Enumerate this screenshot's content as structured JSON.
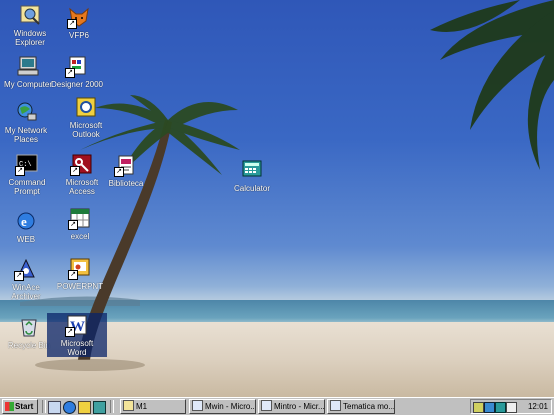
{
  "desktop_icons": [
    {
      "id": "windows-explorer",
      "label": [
        "Windows",
        "Explorer"
      ]
    },
    {
      "id": "vfp6",
      "label": [
        "VFP6"
      ]
    },
    {
      "id": "my-computer",
      "label": [
        "My Computer"
      ]
    },
    {
      "id": "designer-2000",
      "label": [
        "Designer 2000"
      ]
    },
    {
      "id": "my-network-places",
      "label": [
        "My Network",
        "Places"
      ]
    },
    {
      "id": "microsoft-outlook",
      "label": [
        "Microsoft",
        "Outlook"
      ]
    },
    {
      "id": "command-prompt",
      "label": [
        "Command",
        "Prompt"
      ]
    },
    {
      "id": "microsoft-access",
      "label": [
        "Microsoft",
        "Access"
      ]
    },
    {
      "id": "biblioteca",
      "label": [
        "Biblioteca"
      ]
    },
    {
      "id": "calculator",
      "label": [
        "Calculator"
      ]
    },
    {
      "id": "web",
      "label": [
        "WEB"
      ]
    },
    {
      "id": "excel",
      "label": [
        "excel"
      ]
    },
    {
      "id": "winace-archiver",
      "label": [
        "WinAce",
        "Archiver"
      ]
    },
    {
      "id": "powerpnt",
      "label": [
        "POWERPNT"
      ]
    },
    {
      "id": "recycle-bin",
      "label": [
        "Recycle Bin"
      ]
    },
    {
      "id": "microsoft-word",
      "label": [
        "Microsoft",
        "Word"
      ]
    }
  ],
  "taskbar": {
    "start_label": "Start",
    "quick_launch": [
      "desktop-icon",
      "ie-icon",
      "outlook-express-icon",
      "channels-icon"
    ],
    "tasks": [
      {
        "label": "M1"
      },
      {
        "label": "Mwin - Micro..."
      },
      {
        "label": "Mintro - Micr..."
      },
      {
        "label": "Tematica mo..."
      }
    ],
    "tray_icons": [
      "volume-icon",
      "network-icon",
      "monitor-icon",
      "printer-icon"
    ],
    "clock": "12:01"
  },
  "colors": {
    "taskbar": "#c0c0c0",
    "sky": "#3a68c4",
    "sand": "#dcd0bf"
  }
}
